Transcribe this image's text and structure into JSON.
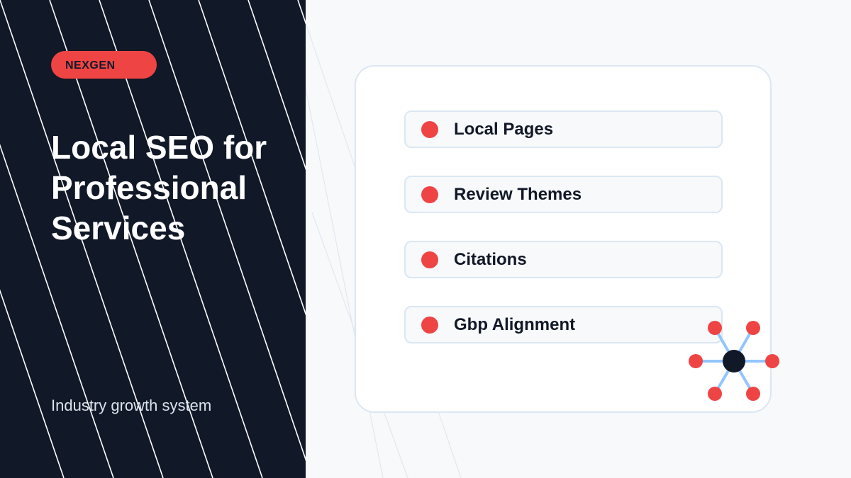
{
  "brand": {
    "badge_label": "NEXGEN"
  },
  "hero": {
    "title": "Local SEO for Professional Services",
    "subtitle": "Industry growth system"
  },
  "checklist": {
    "items": [
      {
        "label": "Local Pages"
      },
      {
        "label": "Review Themes"
      },
      {
        "label": "Citations"
      },
      {
        "label": "Gbp Alignment"
      }
    ]
  },
  "colors": {
    "navy": "#111827",
    "accent_red": "#ef4444",
    "line_blue": "#93c5fd",
    "card_border": "#dbe7f3",
    "page_bg": "#f7f9fb"
  },
  "icons": {
    "bullet": "red-dot-icon",
    "network": "hub-network-icon"
  }
}
